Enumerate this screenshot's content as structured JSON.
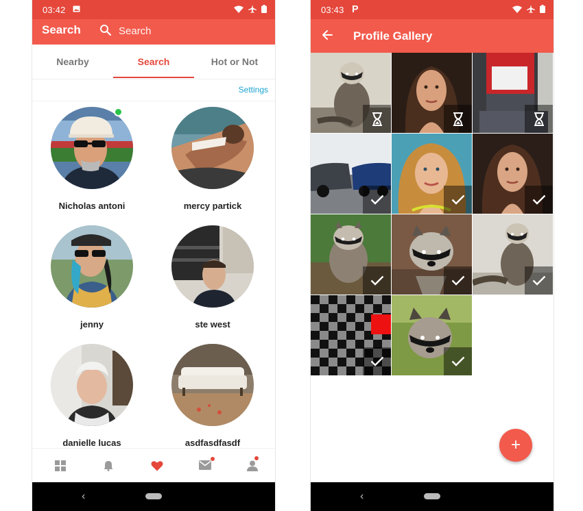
{
  "colors": {
    "accent": "#e5473b",
    "appbar": "#f25a4c",
    "link": "#1aa3cf",
    "online": "#2bc44a"
  },
  "left_screen": {
    "status_bar": {
      "time": "03:42"
    },
    "appbar": {
      "title": "Search",
      "search_placeholder": "Search",
      "search_icon": "search-icon"
    },
    "tabs": [
      {
        "label": "Nearby",
        "active": false
      },
      {
        "label": "Search",
        "active": true
      },
      {
        "label": "Hot or Not",
        "active": false
      }
    ],
    "settings_label": "Settings",
    "users": [
      {
        "name": "Nicholas antoni",
        "online": true
      },
      {
        "name": "mercy partick",
        "online": false
      },
      {
        "name": "jenny",
        "online": false
      },
      {
        "name": "ste west",
        "online": false
      },
      {
        "name": "danielle lucas",
        "online": false
      },
      {
        "name": "asdfasdfasdf",
        "online": false
      }
    ],
    "bottom_nav": [
      {
        "icon": "grid-icon",
        "badge": false
      },
      {
        "icon": "bell-icon",
        "badge": false
      },
      {
        "icon": "heart-icon",
        "badge": false,
        "active": true
      },
      {
        "icon": "mail-icon",
        "badge": true
      },
      {
        "icon": "profile-icon",
        "badge": true
      }
    ]
  },
  "right_screen": {
    "status_bar": {
      "time": "03:43"
    },
    "appbar": {
      "title": "Profile Gallery"
    },
    "photos": [
      {
        "subject": "raccoon",
        "status": "pending"
      },
      {
        "subject": "woman",
        "status": "pending"
      },
      {
        "subject": "red-building",
        "status": "pending"
      },
      {
        "subject": "cars",
        "status": "approved"
      },
      {
        "subject": "woman-blonde",
        "status": "approved"
      },
      {
        "subject": "woman",
        "status": "approved"
      },
      {
        "subject": "raccoon",
        "status": "approved"
      },
      {
        "subject": "raccoon",
        "status": "approved"
      },
      {
        "subject": "raccoon",
        "status": "approved"
      },
      {
        "subject": "checkerboard",
        "status": "approved"
      },
      {
        "subject": "raccoon",
        "status": "approved"
      }
    ],
    "fab_label": "+"
  }
}
